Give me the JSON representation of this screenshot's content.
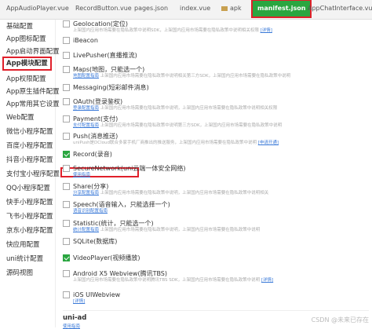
{
  "tabs": [
    {
      "label": "AppAudioPlayer.vue"
    },
    {
      "label": "RecordButton.vue"
    },
    {
      "label": "pages.json"
    },
    {
      "label": "index.vue"
    },
    {
      "label": "apk"
    },
    {
      "label": "manifest.json"
    },
    {
      "label": "AppChatInterface.vue"
    }
  ],
  "sidebar": [
    "基础配置",
    "App图标配置",
    "App启动界面配置",
    "App模块配置",
    "App权限配置",
    "App原生插件配置",
    "App常用其它设置",
    "Web配置",
    "微信小程序配置",
    "百度小程序配置",
    "抖音小程序配置",
    "支付宝小程序配置",
    "QQ小程序配置",
    "快手小程序配置",
    "飞书小程序配置",
    "京东小程序配置",
    "快应用配置",
    "uni统计配置",
    "源码视图"
  ],
  "modules": [
    {
      "label": "Geolocation(定位)",
      "desc": "上架国内应用市场需要在隐私政策中说明SDK，上架国内应用市场需要在隐私政策中说明相关权限",
      "link": "[详情]",
      "checked": false
    },
    {
      "label": "iBeacon",
      "desc": "",
      "link": "",
      "checked": false
    },
    {
      "label": "LivePusher(直播推流)",
      "desc": "",
      "link": "",
      "checked": false
    },
    {
      "label": "Maps(地图，只能选一个)",
      "desc": "上架国内应用市场需要在隐私政策中说明相关第三方SDK，上架国内应用市场需要在隐私政策中说明",
      "link": "地图配置指南",
      "checked": false
    },
    {
      "label": "Messaging(短彩邮件消息)",
      "desc": "",
      "link": "",
      "checked": false
    },
    {
      "label": "OAuth(登录鉴权)",
      "desc": "上架国内应用市场需要在隐私政策中说明，上架国内应用市场需要在隐私政策中说明相关权限",
      "link": "登录配置指南",
      "checked": false
    },
    {
      "label": "Payment(支付)",
      "desc": "上架国内应用市场需要在隐私政策中说明第三方SDK，上架国内应用市场需要在隐私政策中说明",
      "link": "支付配置指南",
      "checked": false
    },
    {
      "label": "Push(消息推送)",
      "desc": "uniPush是DCloud联合多家手机厂商推出的推送服务，上架国内应用市场需要在隐私政策中说明",
      "link": "[申请开通]",
      "checked": false
    },
    {
      "label": "Record(录音)",
      "desc": "",
      "link": "",
      "checked": true
    },
    {
      "label": "SecureNetwork(uni云端一体安全网络)",
      "desc": "",
      "link": "使用指南",
      "checked": false
    },
    {
      "label": "Share(分享)",
      "desc": "上架国内应用市场需要在隐私政策中说明，上架国内应用市场需要在隐私政策中说明相关",
      "link": "分享配置指南",
      "checked": false
    },
    {
      "label": "Speech(语音输入，只能选择一个)",
      "desc": "",
      "link": "语音识别配置指南",
      "checked": false
    },
    {
      "label": "Statistic(统计，只能选一个)",
      "desc": "上架国内应用市场需要在隐私政策中说明，上架国内应用市场需要在隐私政策中说明",
      "link": "统计配置指南",
      "checked": false
    },
    {
      "label": "SQLite(数据库)",
      "desc": "",
      "link": "",
      "checked": false
    },
    {
      "label": "VideoPlayer(视频播放)",
      "desc": "",
      "link": "",
      "checked": true
    },
    {
      "label": "Android X5 Webview(腾讯TBS)",
      "desc": "上架国内应用市场需要在隐私政策中说明腾讯TBS SDK，上架国内应用市场需要在隐私政策中说明",
      "link": "[详情]",
      "checked": false
    },
    {
      "label": "iOS UIWebview",
      "desc": "",
      "link": "[详情]",
      "checked": false
    }
  ],
  "section": {
    "title": "uni-ad",
    "link": "使用指南"
  },
  "watermark": "CSDN @未来已存在"
}
